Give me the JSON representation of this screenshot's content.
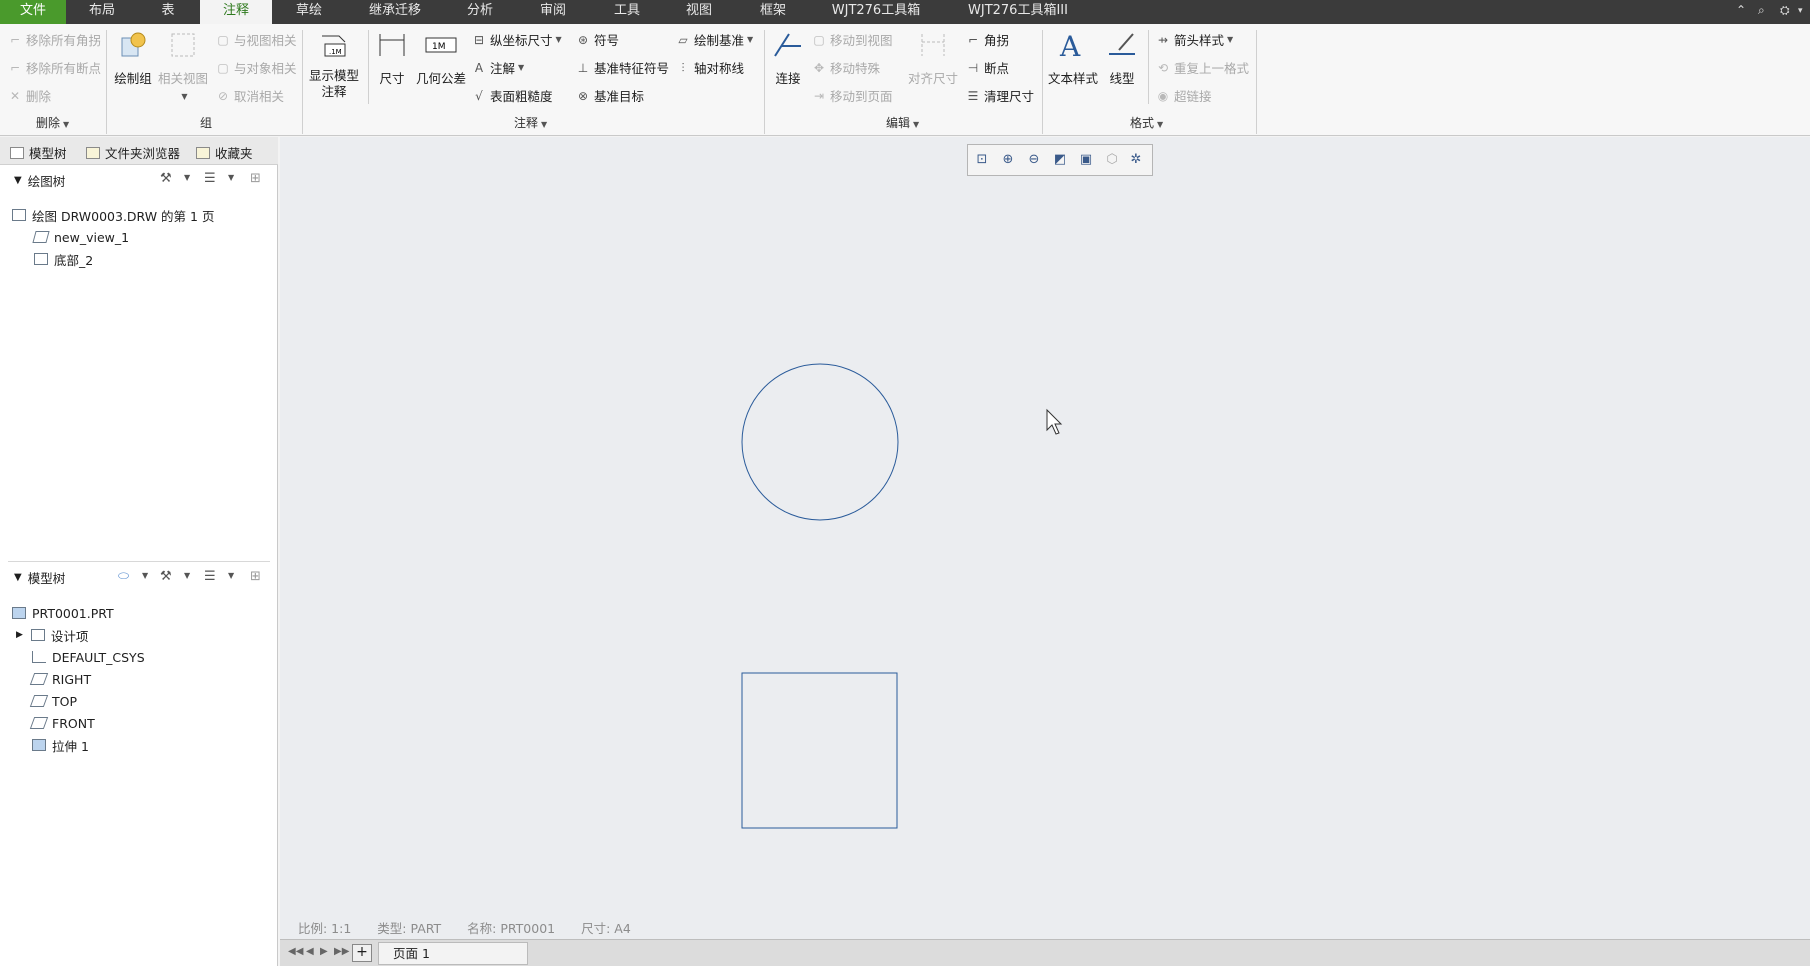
{
  "tabs": [
    "文件",
    "布局",
    "表",
    "注释",
    "草绘",
    "继承迁移",
    "分析",
    "审阅",
    "工具",
    "视图",
    "框架",
    "WJT276工具箱",
    "WJT276工具箱III"
  ],
  "active_tab": "注释",
  "ribbon": {
    "delete_group": {
      "items": [
        "移除所有角拐",
        "移除所有断点",
        "删除"
      ],
      "label": "删除"
    },
    "group_group": {
      "draw_group": "绘制组",
      "related_view": "相关视图",
      "items": [
        "与视图相关",
        "与对象相关",
        "取消相关"
      ],
      "label": "组"
    },
    "annotation_group": {
      "show_model_annotation": "显示模型注释",
      "dimension": "尺寸",
      "geometric_tolerance": "几何公差",
      "ordinate_dimension": "纵坐标尺寸",
      "note": "注解",
      "surface_finish": "表面粗糙度",
      "symbol": "符号",
      "datum_feature_symbol": "基准特征符号",
      "datum_target": "基准目标",
      "draw_datum": "绘制基准",
      "axis_symmetry": "轴对称线",
      "label": "注释"
    },
    "edit_group": {
      "connect": "连接",
      "items": [
        "移动到视图",
        "移动特殊",
        "移动到页面"
      ],
      "align_dimension": "对齐尺寸",
      "right_items": [
        "角拐",
        "断点",
        "清理尺寸"
      ],
      "label": "编辑"
    },
    "format_group": {
      "text_style": "文本样式",
      "line_style": "线型",
      "items": [
        "箭头样式",
        "重复上一格式",
        "超链接"
      ],
      "label": "格式"
    }
  },
  "left_panel": {
    "tabs": [
      "模型树",
      "文件夹浏览器",
      "收藏夹"
    ],
    "drawing_tree": {
      "title": "绘图树",
      "items": [
        "绘图 DRW0003.DRW 的第 1 页",
        "new_view_1",
        "底部_2"
      ]
    },
    "model_tree": {
      "title": "模型树",
      "items": [
        "PRT0001.PRT",
        "设计项",
        "DEFAULT_CSYS",
        "RIGHT",
        "TOP",
        "FRONT",
        "拉伸 1"
      ]
    }
  },
  "status": {
    "scale": "比例: 1:1",
    "type": "类型: PART",
    "name": "名称: PRT0001",
    "size": "尺寸: A4"
  },
  "page_tab": "页面 1",
  "colors": {
    "file_tab": "#4a9a2c",
    "tab_bar": "#3b3b3b",
    "canvas": "#ebedf0",
    "sketch": "#2a5b9a"
  }
}
